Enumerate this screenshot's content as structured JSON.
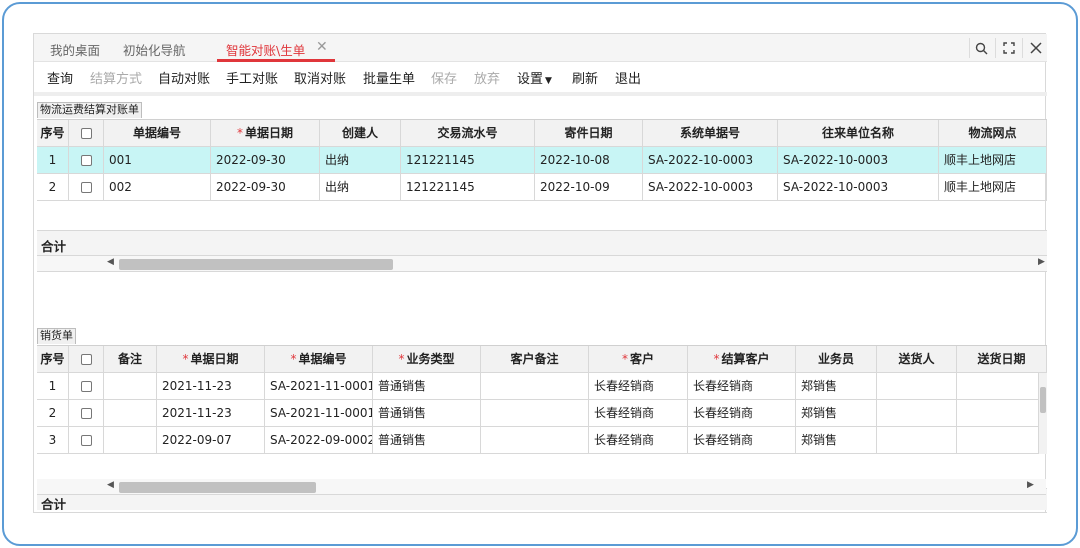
{
  "tabs": [
    {
      "label": "我的桌面"
    },
    {
      "label": "初始化导航"
    },
    {
      "label": "智能对账\\生单",
      "active": true
    }
  ],
  "toolbar": [
    {
      "label": "查询",
      "enabled": true
    },
    {
      "label": "结算方式",
      "enabled": false
    },
    {
      "label": "自动对账",
      "enabled": true
    },
    {
      "label": "手工对账",
      "enabled": true
    },
    {
      "label": "取消对账",
      "enabled": true
    },
    {
      "label": "批量生单",
      "enabled": true
    },
    {
      "label": "保存",
      "enabled": false
    },
    {
      "label": "放弃",
      "enabled": false
    },
    {
      "label": "设置",
      "enabled": true,
      "dropdown": true
    },
    {
      "label": "刷新",
      "enabled": true
    },
    {
      "label": "退出",
      "enabled": true
    }
  ],
  "grid1": {
    "title": "物流运费结算对账单",
    "columns": [
      {
        "label": "序号"
      },
      {
        "label": "",
        "checkbox": true
      },
      {
        "label": "单据编号"
      },
      {
        "label": "单据日期",
        "required": true
      },
      {
        "label": "创建人"
      },
      {
        "label": "交易流水号"
      },
      {
        "label": "寄件日期"
      },
      {
        "label": "系统单据号"
      },
      {
        "label": "往来单位名称"
      },
      {
        "label": "物流网点"
      }
    ],
    "rows": [
      [
        "1",
        "",
        "001",
        "2022-09-30",
        "出纳",
        "121221145",
        "2022-10-08",
        "SA-2022-10-0003",
        "SA-2022-10-0003",
        "顺丰上地网店"
      ],
      [
        "2",
        "",
        "002",
        "2022-09-30",
        "出纳",
        "121221145",
        "2022-10-09",
        "SA-2022-10-0003",
        "SA-2022-10-0003",
        "顺丰上地网店"
      ]
    ],
    "selected_row": 0,
    "total_label": "合计"
  },
  "grid2": {
    "title": "销货单",
    "columns": [
      {
        "label": "序号"
      },
      {
        "label": "",
        "checkbox": true
      },
      {
        "label": "备注"
      },
      {
        "label": "单据日期",
        "required": true
      },
      {
        "label": "单据编号",
        "required": true
      },
      {
        "label": "业务类型",
        "required": true
      },
      {
        "label": "客户备注"
      },
      {
        "label": "客户",
        "required": true
      },
      {
        "label": "结算客户",
        "required": true
      },
      {
        "label": "业务员"
      },
      {
        "label": "送货人"
      },
      {
        "label": "送货日期"
      }
    ],
    "rows": [
      [
        "1",
        "",
        "",
        "2021-11-23",
        "SA-2021-11-0001",
        "普通销售",
        "",
        "长春经销商",
        "长春经销商",
        "郑销售",
        "",
        ""
      ],
      [
        "2",
        "",
        "",
        "2021-11-23",
        "SA-2021-11-0001",
        "普通销售",
        "",
        "长春经销商",
        "长春经销商",
        "郑销售",
        "",
        ""
      ],
      [
        "3",
        "",
        "",
        "2022-09-07",
        "SA-2022-09-0002",
        "普通销售",
        "",
        "长春经销商",
        "长春经销商",
        "郑销售",
        "",
        ""
      ]
    ],
    "total_label": "合计"
  },
  "icons": {
    "search": "search-icon",
    "maximize": "maximize-icon",
    "close": "close-icon",
    "tab_close": "tab-close-icon"
  },
  "colors": {
    "accent": "#e0363b",
    "selected_row": "#c8f5f5",
    "frame": "#5b9bd5"
  }
}
